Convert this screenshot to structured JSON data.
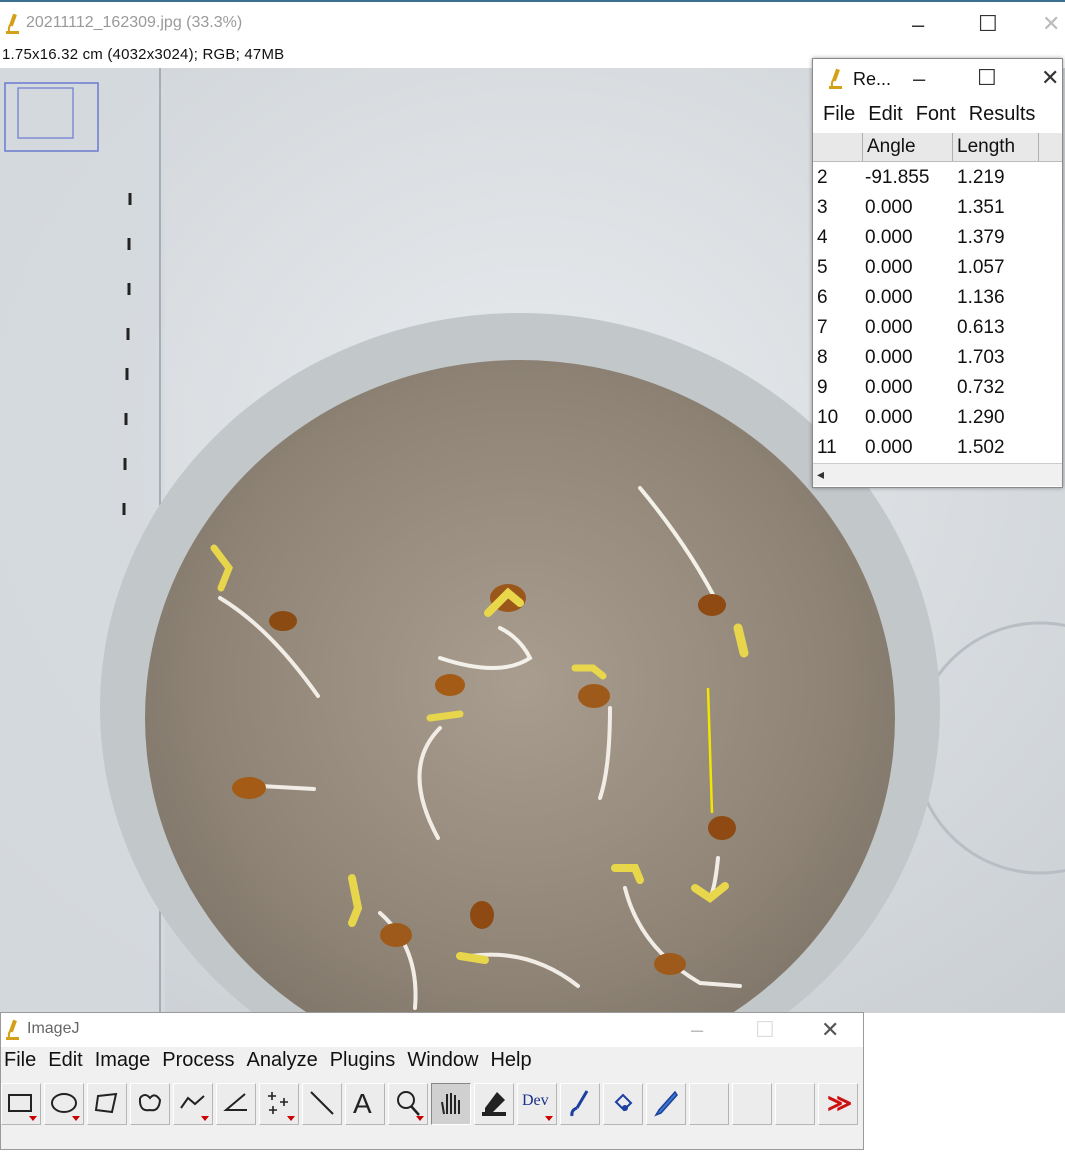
{
  "image_window": {
    "title": "20211112_162309.jpg (33.3%)",
    "info": "1.75x16.32 cm (4032x3024); RGB; 47MB",
    "controls": {
      "minimize": "–",
      "maximize": "☐",
      "close": "✕"
    },
    "icon": "microscope-icon"
  },
  "results_window": {
    "title": "Re...",
    "controls": {
      "minimize": "–",
      "maximize": "☐",
      "close": "✕"
    },
    "menu": [
      "File",
      "Edit",
      "Font",
      "Results"
    ],
    "columns": [
      "",
      "Angle",
      "Length"
    ],
    "rows": [
      {
        "n": "2",
        "angle": "-91.855",
        "length": "1.219"
      },
      {
        "n": "3",
        "angle": "0.000",
        "length": "1.351"
      },
      {
        "n": "4",
        "angle": "0.000",
        "length": "1.379"
      },
      {
        "n": "5",
        "angle": "0.000",
        "length": "1.057"
      },
      {
        "n": "6",
        "angle": "0.000",
        "length": "1.136"
      },
      {
        "n": "7",
        "angle": "0.000",
        "length": "0.613"
      },
      {
        "n": "8",
        "angle": "0.000",
        "length": "1.703"
      },
      {
        "n": "9",
        "angle": "0.000",
        "length": "0.732"
      },
      {
        "n": "10",
        "angle": "0.000",
        "length": "1.290"
      },
      {
        "n": "11",
        "angle": "0.000",
        "length": "1.502"
      }
    ],
    "scroll_left": "◂"
  },
  "imagej_window": {
    "title": "ImageJ",
    "controls": {
      "minimize": "–",
      "maximize": "☐",
      "close": "✕"
    },
    "menu": [
      "File",
      "Edit",
      "Image",
      "Process",
      "Analyze",
      "Plugins",
      "Window",
      "Help"
    ],
    "tools": [
      "rectangle-icon",
      "oval-icon",
      "polygon-icon",
      "freehand-icon",
      "segmented-line-icon",
      "angle-icon",
      "multipoint-icon",
      "straight-line-icon",
      "text-icon",
      "magnifier-icon",
      "hand-icon",
      "color-picker-icon",
      "developer-menu-icon",
      "brush-icon",
      "flood-fill-icon",
      "pencil-icon",
      "empty-slot",
      "empty-slot",
      "empty-slot",
      "more-tools-icon"
    ],
    "text_tool_glyph": "A",
    "dev_label": "Dev",
    "more_glyph": "≫"
  },
  "colors": {
    "accent_red": "#cc1111",
    "measure_line": "#f2e600",
    "titlebar_border": "#3c6e8f"
  }
}
